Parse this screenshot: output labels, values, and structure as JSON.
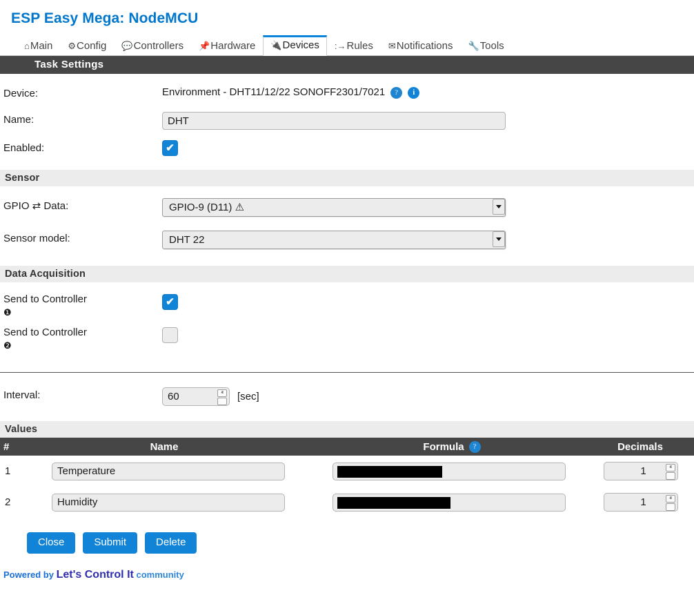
{
  "header": {
    "title": "ESP Easy Mega: NodeMCU"
  },
  "tabs": [
    {
      "label": "Main",
      "icon": "home-icon",
      "glyph": "⌂",
      "icon_class": "ico-main",
      "active": false
    },
    {
      "label": "Config",
      "icon": "gear-icon",
      "glyph": "⚙",
      "icon_class": "ico-config",
      "active": false
    },
    {
      "label": "Controllers",
      "icon": "speech-bubble-icon",
      "glyph": "💬",
      "icon_class": "ico-ctrl",
      "active": false
    },
    {
      "label": "Hardware",
      "icon": "pushpin-icon",
      "glyph": "📌",
      "icon_class": "ico-hw",
      "active": false
    },
    {
      "label": "Devices",
      "icon": "plug-icon",
      "glyph": "🔌",
      "icon_class": "ico-dev",
      "active": true
    },
    {
      "label": "Rules",
      "icon": "arrow-flow-icon",
      "glyph": ":→",
      "icon_class": "ico-rules",
      "active": false
    },
    {
      "label": "Notifications",
      "icon": "envelope-icon",
      "glyph": "✉",
      "icon_class": "ico-notif",
      "active": false
    },
    {
      "label": "Tools",
      "icon": "wrench-icon",
      "glyph": "🔧",
      "icon_class": "ico-tools",
      "active": false
    }
  ],
  "task_settings": {
    "section_title": "Task Settings",
    "device": {
      "label": "Device:",
      "value": "Environment - DHT11/12/22 SONOFF2301/7021",
      "help_badge": "?",
      "info_badge": "i"
    },
    "name": {
      "label": "Name:",
      "value": "DHT",
      "placeholder": ""
    },
    "enabled": {
      "label": "Enabled:",
      "checked": true,
      "check_glyph": "✔"
    }
  },
  "sensor": {
    "section_title": "Sensor",
    "gpio": {
      "label": "GPIO ⇄ Data:",
      "value": "GPIO-9 (D11) ⚠"
    },
    "model": {
      "label": "Sensor model:",
      "value": "DHT 22"
    }
  },
  "data_acquisition": {
    "section_title": "Data Acquisition",
    "controllers": [
      {
        "label": "Send to Controller",
        "number": "❶",
        "checked": true,
        "check_glyph": "✔"
      },
      {
        "label": "Send to Controller",
        "number": "❷",
        "checked": false,
        "check_glyph": ""
      }
    ]
  },
  "interval": {
    "label": "Interval:",
    "value": "60",
    "unit": "[sec]",
    "spin_up": "ⱏ",
    "spin_down": "ⱟ"
  },
  "values": {
    "section_title": "Values",
    "columns": {
      "num": "#",
      "name": "Name",
      "formula": "Formula",
      "formula_help": "?",
      "decimals": "Decimals"
    },
    "rows": [
      {
        "num": "1",
        "name": "Temperature",
        "formula": "",
        "formula_redacted": true,
        "redact_width": 152,
        "decimals": "1"
      },
      {
        "num": "2",
        "name": "Humidity",
        "formula": "",
        "formula_redacted": true,
        "redact_width": 164,
        "decimals": "1"
      }
    ]
  },
  "buttons": {
    "close": "Close",
    "submit": "Submit",
    "delete": "Delete"
  },
  "footer": {
    "powered_by": "Powered by",
    "brand": "Let's Control It",
    "community": "community"
  },
  "colors": {
    "accent_blue": "#1284d8",
    "brand_blue": "#0077cc",
    "bar_dark": "#464646",
    "bar_light": "#ececec",
    "input_bg": "#ececec",
    "tab_active_top": "#0b84d9"
  }
}
